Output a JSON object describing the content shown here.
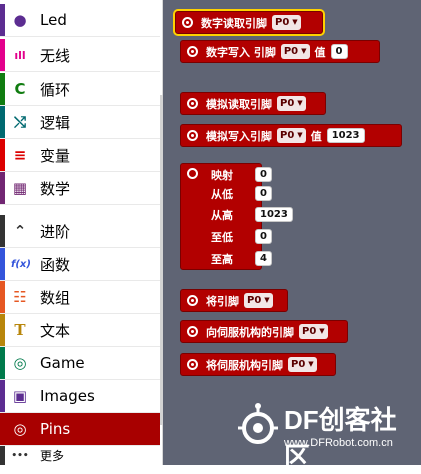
{
  "sidebar": {
    "categories": [
      {
        "label": "Led",
        "icon": "toggle-icon",
        "glyph": "●",
        "color": "#5c2d91"
      },
      {
        "label": "无线",
        "icon": "signal-icon",
        "glyph": "ıll",
        "color": "#e3008c"
      },
      {
        "label": "循环",
        "icon": "loop-icon",
        "glyph": "C",
        "color": "#107c10"
      },
      {
        "label": "逻辑",
        "icon": "shuffle-icon",
        "glyph": "⤭",
        "color": "#006970"
      },
      {
        "label": "变量",
        "icon": "list-icon",
        "glyph": "≡",
        "color": "#dc0000"
      },
      {
        "label": "数学",
        "icon": "calculator-icon",
        "glyph": "▦",
        "color": "#712672"
      },
      {
        "label": "进阶",
        "icon": "chevron-up-icon",
        "glyph": "⌃",
        "color": "#333333"
      },
      {
        "label": "函数",
        "icon": "function-icon",
        "glyph": "f(x)",
        "color": "#3455db"
      },
      {
        "label": "数组",
        "icon": "array-icon",
        "glyph": "☷",
        "color": "#e65722"
      },
      {
        "label": "文本",
        "icon": "text-icon",
        "glyph": "T",
        "color": "#b8860b"
      },
      {
        "label": "Game",
        "icon": "gamepad-icon",
        "glyph": "◎",
        "color": "#007a4b"
      },
      {
        "label": "Images",
        "icon": "image-icon",
        "glyph": "▣",
        "color": "#5c2d91"
      },
      {
        "label": "Pins",
        "icon": "pins-icon",
        "glyph": "◎",
        "color": "#ffffff"
      },
      {
        "label": "更多",
        "icon": "more-icon",
        "glyph": "•••",
        "color": "#333333"
      }
    ]
  },
  "blocks": {
    "digital_read": {
      "label": "数字读取引脚",
      "pin": "P0"
    },
    "digital_write": {
      "label": "数字写入 引脚",
      "pin": "P0",
      "value_label": "值",
      "value": "0"
    },
    "analog_read": {
      "label": "模拟读取引脚",
      "pin": "P0"
    },
    "analog_write": {
      "label": "模拟写入引脚",
      "pin": "P0",
      "value_label": "值",
      "value": "1023"
    },
    "map": {
      "title": "映射",
      "title_value": "0",
      "from_low_label": "从低",
      "from_low": "0",
      "from_high_label": "从高",
      "from_high": "1023",
      "to_low_label": "至低",
      "to_low": "0",
      "to_high_label": "至高",
      "to_high": "4"
    },
    "pin_block": {
      "label": "将引脚",
      "pin": "P0"
    },
    "servo_pin": {
      "label": "向伺服机构的引脚",
      "pin": "P0"
    },
    "servo_pin2": {
      "label": "将伺服机构引脚",
      "pin": "P0"
    }
  },
  "watermark": {
    "title": "DF创客社区",
    "url": "www.DFRobot.com.cn"
  },
  "colors": {
    "pins": "#a80000",
    "workspace": "#5f6474",
    "selected_outline": "#ffd200"
  }
}
